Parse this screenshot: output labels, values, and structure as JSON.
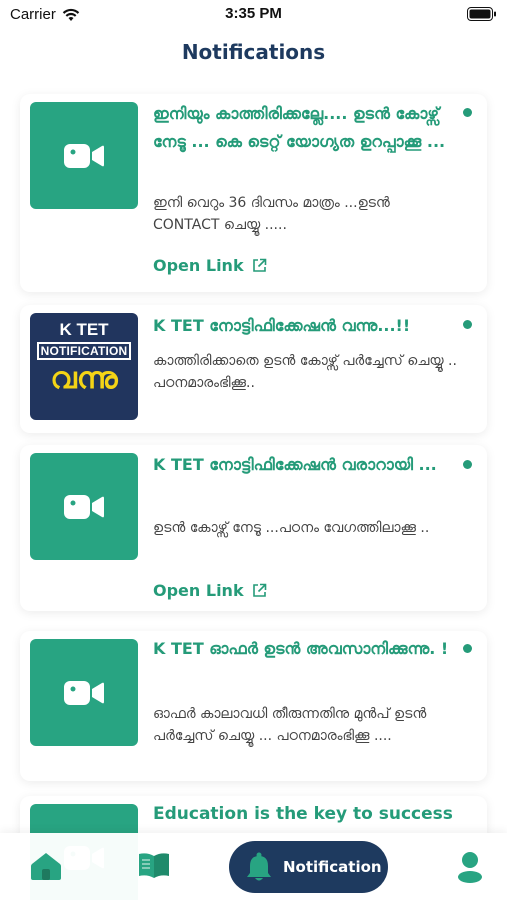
{
  "status": {
    "carrier": "Carrier",
    "time": "3:35 PM"
  },
  "header": {
    "title": "Notifications"
  },
  "notifications": [
    {
      "title": "ഇനിയും കാത്തിരിക്കല്ലേ.... ഉടൻ കോഴ്സ് നേടൂ ... കെ ടെറ്റ് യോഗ്യത ഉറപ്പാക്കൂ ...",
      "body": "ഇനി വെറും 36 ദിവസം മാത്രം ...ഉടൻ CONTACT ചെയ്യൂ .....",
      "link": "Open Link",
      "thumbnail": "video-icon"
    },
    {
      "title": "K TET നോട്ടിഫിക്കേഷൻ വന്നു...!!",
      "body": "കാത്തിരിക്കാതെ ഉടൻ കോഴ്സ് പർച്ചേസ് ചെയ്യൂ .. പഠനമാരംഭിക്കൂ..",
      "thumbnail": "banner-image",
      "banner": {
        "line1": "K TET",
        "line2": "NOTIFICATION",
        "line3": "വന്നു"
      }
    },
    {
      "title": "K  TET നോട്ടിഫിക്കേഷൻ വരാറായി ...",
      "body": "ഉടൻ കോഴ്സ് നേടൂ ...പഠനം വേഗത്തിലാക്കൂ ..",
      "link": "Open Link",
      "thumbnail": "video-icon"
    },
    {
      "title": "K TET ഓഫർ ഉടൻ അവസാനിക്കുന്നു. !",
      "body": "ഓഫർ കാലാവധി തീരുന്നതിനു മുൻപ് ഉടൻ പർച്ചേസ് ചെയ്യൂ ... പഠനമാരംഭിക്കൂ ....",
      "thumbnail": "video-icon"
    },
    {
      "title": "Education is the key to success",
      "thumbnail": "video-icon"
    }
  ],
  "bottom_nav": {
    "active_label": "Notification"
  },
  "colors": {
    "accent": "#259b79",
    "navy": "#1e3a5f",
    "thumb_bg": "#28a482"
  }
}
